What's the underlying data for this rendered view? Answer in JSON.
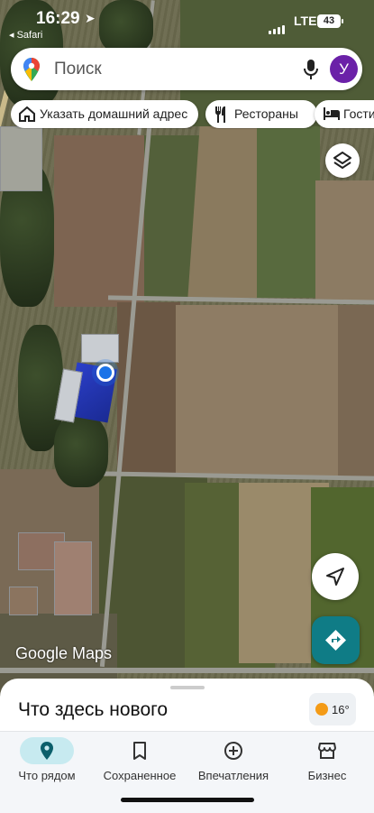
{
  "status_bar": {
    "time": "16:29",
    "back_app": "◂ Safari",
    "network": "LTE",
    "battery": "43"
  },
  "search": {
    "placeholder": "Поиск",
    "avatar_letter": "У"
  },
  "chips": [
    {
      "label": "Указать домашний адрес",
      "icon": "home-icon"
    },
    {
      "label": "Рестораны",
      "icon": "restaurant-icon"
    },
    {
      "label": "Гостиницы",
      "icon": "hotel-icon"
    }
  ],
  "map": {
    "logo": "Google Maps"
  },
  "sheet": {
    "title": "Что здесь нового",
    "temperature": "16°"
  },
  "bottom_nav": [
    {
      "label": "Что рядом",
      "icon": "location-pin-icon",
      "active": true
    },
    {
      "label": "Сохраненное",
      "icon": "bookmark-icon",
      "active": false
    },
    {
      "label": "Впечатления",
      "icon": "add-circle-icon",
      "active": false
    },
    {
      "label": "Бизнес",
      "icon": "storefront-icon",
      "active": false
    }
  ],
  "colors": {
    "accent": "#1a73e8",
    "directions_button": "#0f7c86",
    "avatar": "#6b21a8",
    "active_nav_pill": "#c7eaf0"
  }
}
